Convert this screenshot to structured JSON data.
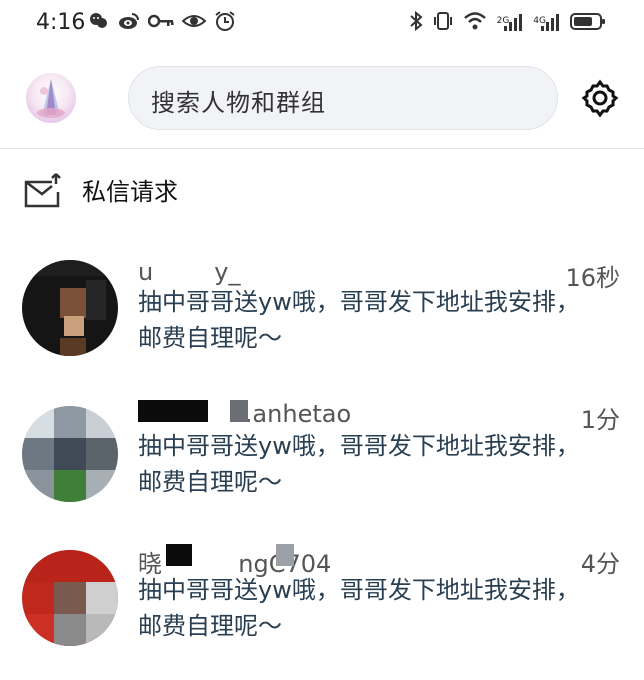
{
  "status_bar": {
    "time": "4:16",
    "icons_left": [
      "chat-bubble-icon",
      "weibo-icon",
      "key-icon",
      "eye-icon",
      "alarm-icon"
    ],
    "icons_right": [
      "bluetooth-icon",
      "vibrate-icon",
      "wifi-icon",
      "signal-2g-icon",
      "signal-4g-icon",
      "battery-icon"
    ],
    "net1": "2G",
    "net2": "4G"
  },
  "header": {
    "search_placeholder": "搜索人物和群组",
    "settings_icon": "gear-icon"
  },
  "dm_requests": {
    "label": "私信请求",
    "icon": "envelope-arrow-icon"
  },
  "conversations": [
    {
      "name": "u        y_",
      "time": "16秒",
      "message": "抽中哥哥送yw哦，哥哥发下地址我安排，邮费自理呢～"
    },
    {
      "name": "            ...anhetao",
      "time": "1分",
      "message": "抽中哥哥送yw哦，哥哥发下地址我安排，邮费自理呢～"
    },
    {
      "name": "晓          ngC704",
      "time": "4分",
      "message": "抽中哥哥送yw哦，哥哥发下地址我安排，邮费自理呢～"
    }
  ],
  "colors": {
    "message_text": "#2a4052",
    "search_bg": "#f2f3f6",
    "divider": "#e6e6e6"
  }
}
